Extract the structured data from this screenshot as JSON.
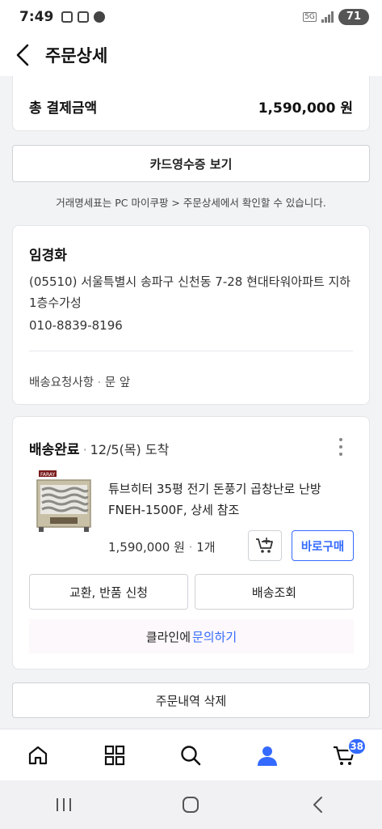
{
  "status_bar": {
    "time": "7:49",
    "network": "5G",
    "battery": "71"
  },
  "header": {
    "title": "주문상세"
  },
  "summary": {
    "total_label": "총 결제금액",
    "total_value": "1,590,000 원"
  },
  "receipt_button": "카드영수증 보기",
  "notice": "거래명세표는 PC 마이쿠팡 > 주문상세에서 확인할 수 있습니다.",
  "address": {
    "name": "임경화",
    "address": "(05510) 서울특별시 송파구 신천동 7-28 현대타워아파트 지하 1층수가성",
    "phone": "010-8839-8196",
    "request_label": "배송요청사항",
    "request_value": "문 앞"
  },
  "order": {
    "status": "배송완료",
    "delivery_date": "12/5(목) 도착",
    "product_name": "튜브히터 35평 전기 돈풍기 곱창난로 난방 FNEH-1500F, 상세 참조",
    "thumb_brand": "FARAY",
    "price": "1,590,000 원",
    "quantity": "1개",
    "buy_now": "바로구매",
    "exchange_return": "교환, 반품 신청",
    "track_delivery": "배송조회",
    "seller": "클라인에",
    "ask": "문의하기"
  },
  "delete_button": "주문내역 삭제",
  "bottom_nav": {
    "cart_count": "38"
  },
  "colors": {
    "accent": "#346aff",
    "border": "#cfd2d6",
    "background": "#f2f3f5"
  }
}
